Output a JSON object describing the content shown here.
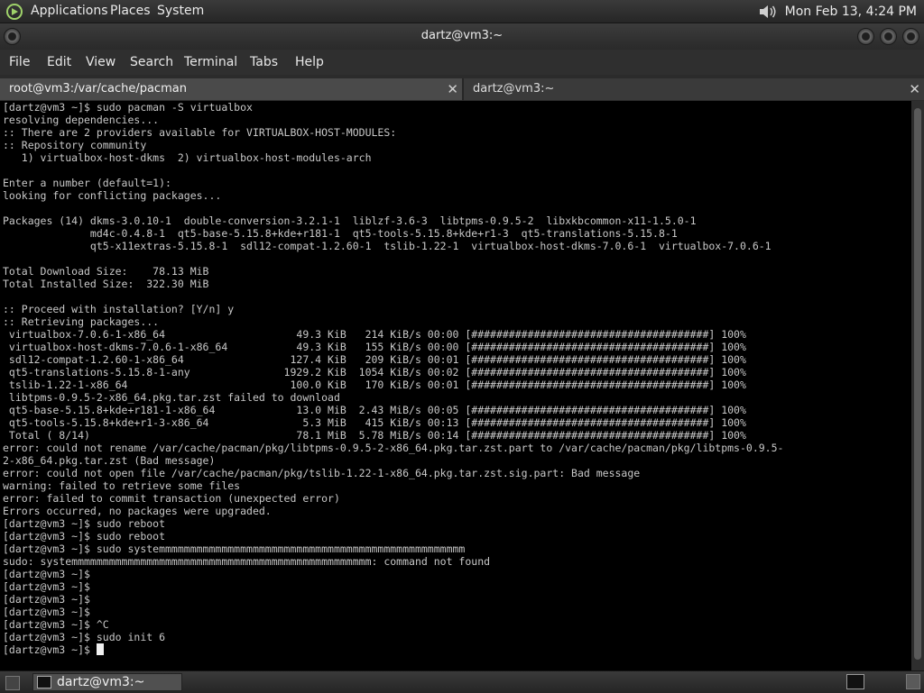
{
  "panel": {
    "menus": [
      "Applications",
      "Places",
      "System"
    ],
    "clock": "Mon Feb 13,  4:24 PM",
    "icons": {
      "logo": "app-logo-icon",
      "volume": "speaker-icon"
    }
  },
  "window": {
    "title": "dartz@vm3:~",
    "menus": [
      "File",
      "Edit",
      "View",
      "Search",
      "Terminal",
      "Tabs",
      "Help"
    ]
  },
  "tabs": [
    {
      "label": "root@vm3:/var/cache/pacman",
      "close": "✕"
    },
    {
      "label": "dartz@vm3:~",
      "close": "✕"
    }
  ],
  "terminal": {
    "lines": [
      "[dartz@vm3 ~]$ sudo pacman -S virtualbox",
      "resolving dependencies...",
      ":: There are 2 providers available for VIRTUALBOX-HOST-MODULES:",
      ":: Repository community",
      "   1) virtualbox-host-dkms  2) virtualbox-host-modules-arch",
      "",
      "Enter a number (default=1):",
      "looking for conflicting packages...",
      "",
      "Packages (14) dkms-3.0.10-1  double-conversion-3.2.1-1  liblzf-3.6-3  libtpms-0.9.5-2  libxkbcommon-x11-1.5.0-1",
      "              md4c-0.4.8-1  qt5-base-5.15.8+kde+r181-1  qt5-tools-5.15.8+kde+r1-3  qt5-translations-5.15.8-1",
      "              qt5-x11extras-5.15.8-1  sdl12-compat-1.2.60-1  tslib-1.22-1  virtualbox-host-dkms-7.0.6-1  virtualbox-7.0.6-1",
      "",
      "Total Download Size:    78.13 MiB",
      "Total Installed Size:  322.30 MiB",
      "",
      ":: Proceed with installation? [Y/n] y",
      ":: Retrieving packages...",
      " virtualbox-7.0.6-1-x86_64                     49.3 KiB   214 KiB/s 00:00 [######################################] 100%",
      " virtualbox-host-dkms-7.0.6-1-x86_64           49.3 KiB   155 KiB/s 00:00 [######################################] 100%",
      " sdl12-compat-1.2.60-1-x86_64                 127.4 KiB   209 KiB/s 00:01 [######################################] 100%",
      " qt5-translations-5.15.8-1-any               1929.2 KiB  1054 KiB/s 00:02 [######################################] 100%",
      " tslib-1.22-1-x86_64                          100.0 KiB   170 KiB/s 00:01 [######################################] 100%",
      " libtpms-0.9.5-2-x86_64.pkg.tar.zst failed to download",
      " qt5-base-5.15.8+kde+r181-1-x86_64             13.0 MiB  2.43 MiB/s 00:05 [######################################] 100%",
      " qt5-tools-5.15.8+kde+r1-3-x86_64               5.3 MiB   415 KiB/s 00:13 [######################################] 100%",
      " Total ( 8/14)                                 78.1 MiB  5.78 MiB/s 00:14 [######################################] 100%",
      "error: could not rename /var/cache/pacman/pkg/libtpms-0.9.5-2-x86_64.pkg.tar.zst.part to /var/cache/pacman/pkg/libtpms-0.9.5-",
      "2-x86_64.pkg.tar.zst (Bad message)",
      "error: could not open file /var/cache/pacman/pkg/tslib-1.22-1-x86_64.pkg.tar.zst.sig.part: Bad message",
      "warning: failed to retrieve some files",
      "error: failed to commit transaction (unexpected error)",
      "Errors occurred, no packages were upgraded.",
      "[dartz@vm3 ~]$ sudo reboot",
      "[dartz@vm3 ~]$ sudo reboot",
      "[dartz@vm3 ~]$ sudo systemmmmmmmmmmmmmmmmmmmmmmmmmmmmmmmmmmmmmmmmmmmmmmmmm",
      "sudo: systemmmmmmmmmmmmmmmmmmmmmmmmmmmmmmmmmmmmmmmmmmmmmmmm: command not found",
      "[dartz@vm3 ~]$",
      "[dartz@vm3 ~]$",
      "[dartz@vm3 ~]$",
      "[dartz@vm3 ~]$",
      "[dartz@vm3 ~]$ ^C",
      "[dartz@vm3 ~]$ sudo init 6"
    ],
    "prompt": "[dartz@vm3 ~]$ "
  },
  "taskbar": {
    "task_label": "dartz@vm3:~",
    "icons": {
      "show_desktop": "show-desktop-icon",
      "terminal": "terminal-icon",
      "tray_terminal": "terminal-icon",
      "tray_box": "workspace-switcher-icon"
    }
  },
  "colors": {
    "terminal_bg": "#000000",
    "terminal_fg": "#c8c8c8",
    "panel_bg": "#2f2f2f"
  }
}
